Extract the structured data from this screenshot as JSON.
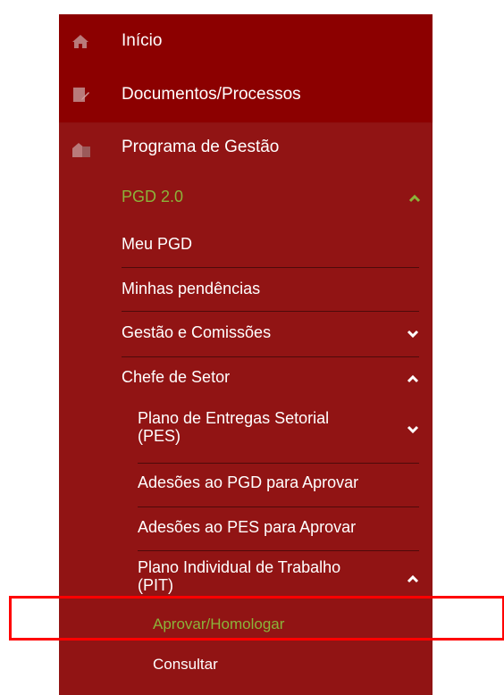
{
  "menu": {
    "inicio": "Início",
    "documentos": "Documentos/Processos",
    "programa": "Programa de Gestão",
    "pgd": "PGD 2.0",
    "meu_pgd": "Meu PGD",
    "minhas_pendencias": "Minhas pendências",
    "gestao_comissoes": "Gestão e Comissões",
    "chefe_setor": "Chefe de Setor",
    "pes_line1": "Plano de Entregas Setorial",
    "pes_line2": "(PES)",
    "adesoes_pgd": "Adesões ao PGD para Aprovar",
    "adesoes_pes": "Adesões ao PES para Aprovar",
    "pit_line1": "Plano Individual de Trabalho",
    "pit_line2": "(PIT)",
    "aprovar": "Aprovar/Homologar",
    "consultar": "Consultar"
  },
  "colors": {
    "menu_bg": "#8c0000",
    "section_bg": "#911414",
    "active_green": "#8bb33a",
    "highlight": "#ff0000"
  },
  "icons": {
    "inicio": "home-icon",
    "documentos": "document-edit-icon",
    "programa": "buildings-icon"
  }
}
